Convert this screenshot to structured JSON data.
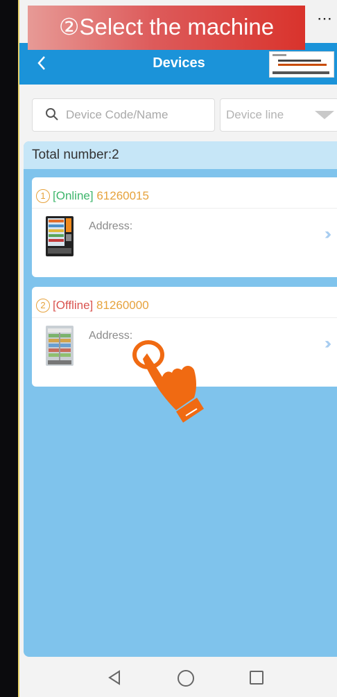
{
  "overlay": {
    "step_label": "②Select the machine"
  },
  "topbar": {
    "close_icon": "×",
    "more_icon": "⋯"
  },
  "header": {
    "title": "Devices"
  },
  "search": {
    "placeholder": "Device Code/Name",
    "device_line_label": "Device line"
  },
  "summary": {
    "total_label": "Total number:2"
  },
  "devices": [
    {
      "index": "1",
      "status": "[Online]",
      "code": "61260015",
      "address_label": "Address:"
    },
    {
      "index": "2",
      "status": "[Offline]",
      "code": "81260000",
      "address_label": "Address:"
    }
  ],
  "colors": {
    "header_blue": "#1b93d9",
    "content_blue": "#7fc3ec",
    "online": "#3db56b",
    "offline": "#d9534f",
    "code": "#e6a23c",
    "pointer_hand": "#f06a12"
  },
  "icons": [
    "close-icon",
    "more-icon",
    "back-arrow-icon",
    "search-icon",
    "dropdown-icon",
    "double-chevron-right-icon",
    "pointer-hand-icon",
    "nav-back-icon",
    "nav-home-icon",
    "nav-recents-icon"
  ]
}
